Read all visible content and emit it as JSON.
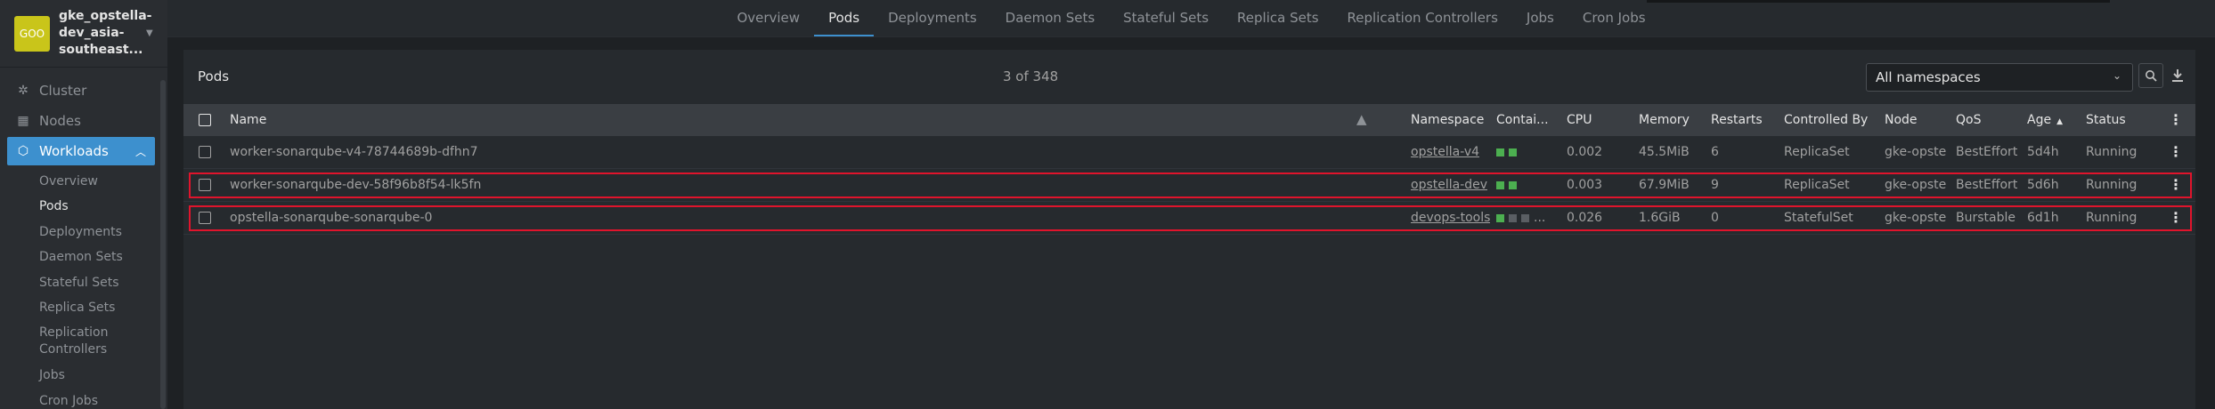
{
  "sidebar": {
    "cluster_badge": "GOO",
    "cluster_name": "gke_opstella-dev_asia-southeast...",
    "items": [
      {
        "label": "Cluster",
        "icon": "cluster-icon"
      },
      {
        "label": "Nodes",
        "icon": "nodes-icon"
      },
      {
        "label": "Workloads",
        "icon": "workloads-icon"
      }
    ],
    "sub_items": [
      "Overview",
      "Pods",
      "Deployments",
      "Daemon Sets",
      "Stateful Sets",
      "Replica Sets",
      "Replication Controllers",
      "Jobs",
      "Cron Jobs"
    ]
  },
  "tabs": [
    "Overview",
    "Pods",
    "Deployments",
    "Daemon Sets",
    "Stateful Sets",
    "Replica Sets",
    "Replication Controllers",
    "Jobs",
    "Cron Jobs"
  ],
  "panel": {
    "title": "Pods",
    "count": "3 of 348",
    "namespace_select": "All namespaces"
  },
  "table": {
    "headers": [
      "Name",
      "Namespace",
      "Contai...",
      "CPU",
      "Memory",
      "Restarts",
      "Controlled By",
      "Node",
      "QoS",
      "Age",
      "Status"
    ],
    "rows": [
      {
        "name": "worker-sonarqube-v4-78744689b-dfhn7",
        "namespace": "opstella-v4",
        "containers": [
          "green",
          "green"
        ],
        "cpu": "0.002",
        "memory": "45.5MiB",
        "restarts": "6",
        "controlled_by": "ReplicaSet",
        "node": "gke-opste",
        "qos": "BestEffort",
        "age": "5d4h",
        "status": "Running",
        "highlighted": false
      },
      {
        "name": "worker-sonarqube-dev-58f96b8f54-lk5fn",
        "namespace": "opstella-dev",
        "containers": [
          "green",
          "green"
        ],
        "cpu": "0.003",
        "memory": "67.9MiB",
        "restarts": "9",
        "controlled_by": "ReplicaSet",
        "node": "gke-opste",
        "qos": "BestEffort",
        "age": "5d6h",
        "status": "Running",
        "highlighted": true
      },
      {
        "name": "opstella-sonarqube-sonarqube-0",
        "namespace": "devops-tools",
        "containers": [
          "green",
          "grey",
          "grey",
          "..."
        ],
        "cpu": "0.026",
        "memory": "1.6GiB",
        "restarts": "0",
        "controlled_by": "StatefulSet",
        "node": "gke-opste",
        "qos": "Burstable",
        "age": "6d1h",
        "status": "Running",
        "highlighted": true
      }
    ]
  },
  "colors": {
    "accent": "#3d90ce",
    "running": "#4caf50",
    "highlight": "#e0142c",
    "badge": "#c9c51a"
  }
}
